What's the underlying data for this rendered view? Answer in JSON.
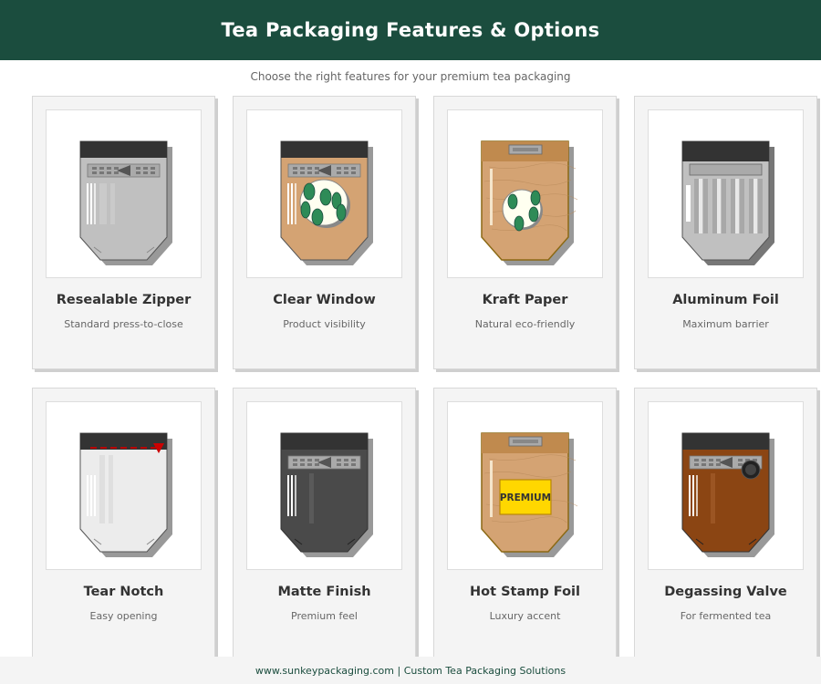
{
  "header": {
    "title": "Tea Packaging Features & Options"
  },
  "subtitle": "Choose the right features for your premium tea packaging",
  "cards": [
    {
      "title": "Resealable Zipper",
      "desc": "Standard press-to-close"
    },
    {
      "title": "Clear Window",
      "desc": "Product visibility"
    },
    {
      "title": "Kraft Paper",
      "desc": "Natural eco-friendly"
    },
    {
      "title": "Aluminum Foil",
      "desc": "Maximum barrier"
    },
    {
      "title": "Tear Notch",
      "desc": "Easy opening"
    },
    {
      "title": "Matte Finish",
      "desc": "Premium feel"
    },
    {
      "title": "Hot Stamp Foil",
      "desc": "Luxury accent",
      "stamp_label": "PREMIUM"
    },
    {
      "title": "Degassing Valve",
      "desc": "For fermented tea"
    }
  ],
  "footer": {
    "text": "www.sunkeypackaging.com | Custom Tea Packaging Solutions"
  },
  "colors": {
    "brand_green": "#1b4d3e",
    "silver_bag": "#c0c0c0",
    "kraft_bag": "#d4a373",
    "white_bag": "#ececec",
    "matte_bag": "#4a4a4a",
    "brown_bag": "#8b4513",
    "stamp_gold": "#ffd700",
    "tear_red": "#cc0000"
  }
}
